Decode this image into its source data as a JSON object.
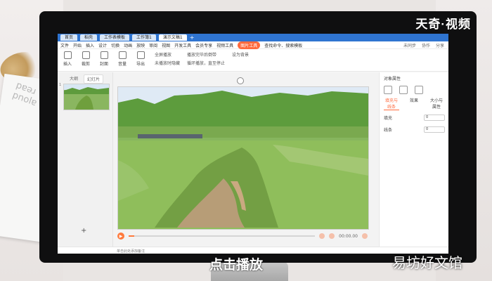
{
  "brand": {
    "text": "天奇·视频"
  },
  "caption": {
    "text": "点击播放"
  },
  "watermark": {
    "text": "易坊好文馆"
  },
  "tabs": [
    {
      "label": "首页"
    },
    {
      "label": "稻壳"
    },
    {
      "label": "工作表模板"
    },
    {
      "label": "工作簿1"
    },
    {
      "label": "演示文稿1"
    }
  ],
  "ribbon": {
    "menu_label": "文件",
    "items": [
      "开始",
      "插入",
      "设计",
      "切换",
      "动画",
      "放映",
      "审阅",
      "视图",
      "开发工具",
      "会员专享",
      "视频工具"
    ],
    "active": "图片工具",
    "search_text": "查找命令、搜索模板",
    "right": [
      "未同步",
      "协作",
      "分享"
    ]
  },
  "toolbar": {
    "tools": [
      {
        "label": "插入"
      },
      {
        "label": "裁剪"
      },
      {
        "label": "封面"
      },
      {
        "label": "音量"
      },
      {
        "label": "导出"
      }
    ],
    "options_left": [
      "全屏播放",
      "未播放时隐藏"
    ],
    "options_mid": [
      "播放完毕后倒带",
      "循环播放，直至停止"
    ],
    "options_right": [
      "设为背景"
    ]
  },
  "left_panel": {
    "tabs": [
      "大纲",
      "幻灯片"
    ],
    "active_tab": "幻灯片",
    "slide_number": "1"
  },
  "player": {
    "time": "00:00.00",
    "progress": 0.03
  },
  "right_panel": {
    "title": "对象属性",
    "tabs": [
      "填充与线条",
      "效果",
      "大小与属性"
    ],
    "active_tab": "填充与线条",
    "rows": [
      {
        "label": "填充",
        "value": "0"
      },
      {
        "label": "线条",
        "value": "0"
      }
    ]
  },
  "status": {
    "text": "单击此处添加备注"
  },
  "colors": {
    "accent": "#ff6a3d",
    "tabbar": "#2f74d0",
    "monitor_bezel": "#0f0f10"
  }
}
